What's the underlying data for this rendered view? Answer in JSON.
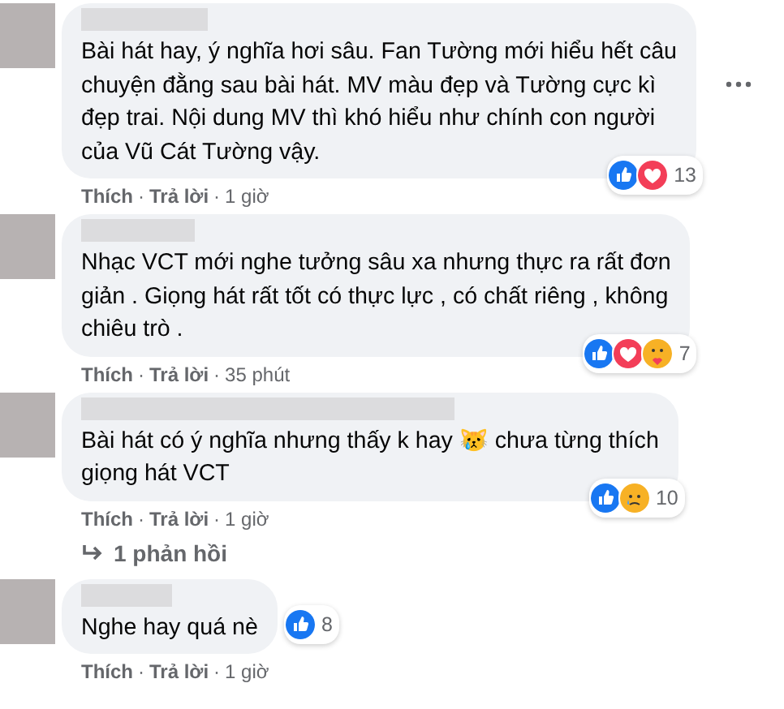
{
  "comments": [
    {
      "text": "Bài hát hay, ý nghĩa hơi sâu. Fan Tường mới hiểu hết câu\nchuyện đằng sau bài hát. MV màu đẹp và Tường cực kì\nđẹp trai. Nội dung MV thì khó hiểu như chính con người\ncủa Vũ Cát Tường vậy.",
      "reactions": [
        {
          "kind": "like"
        },
        {
          "kind": "love"
        }
      ],
      "count": "13",
      "like": "Thích",
      "reply": "Trả lời",
      "separators": [
        "·",
        "·"
      ],
      "time": "1 giờ",
      "menu": true,
      "inline_badge": false
    },
    {
      "text": "Nhạc VCT mới nghe tưởng sâu xa nhưng thực ra rất đơn\ngiản . Giọng hát rất tốt có thực lực , có chất riêng , không\nchiêu trò .",
      "reactions": [
        {
          "kind": "like"
        },
        {
          "kind": "love"
        },
        {
          "kind": "care"
        }
      ],
      "count": "7",
      "like": "Thích",
      "reply": "Trả lời",
      "separators": [
        "·",
        "·"
      ],
      "time": "35 phút",
      "menu": false,
      "inline_badge": false
    },
    {
      "text": "Bài hát có ý nghĩa nhưng thấy k hay 😿 chưa từng thích\ngiọng hát VCT",
      "reactions": [
        {
          "kind": "like"
        },
        {
          "kind": "sad"
        }
      ],
      "count": "10",
      "like": "Thích",
      "reply": "Trả lời",
      "separators": [
        "·",
        "·"
      ],
      "time": "1 giờ",
      "menu": false,
      "inline_badge": false,
      "replies": "1 phản hồi"
    },
    {
      "text": "Nghe hay quá nè",
      "reactions": [
        {
          "kind": "like"
        }
      ],
      "count": "8",
      "like": "Thích",
      "reply": "Trả lời",
      "separators": [
        "·",
        "·"
      ],
      "time": "1 giờ",
      "menu": false,
      "inline_badge": true
    }
  ]
}
